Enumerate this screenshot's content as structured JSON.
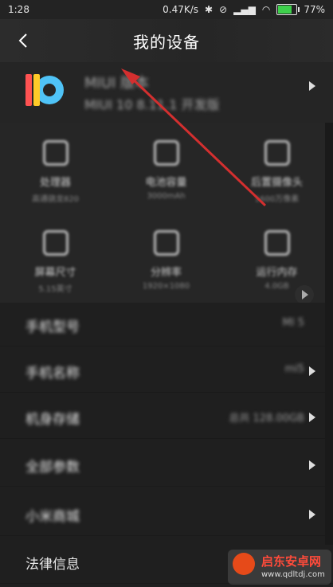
{
  "status": {
    "time": "1:28",
    "net_speed": "0.47K/s",
    "battery": "77%",
    "battery_level": 0.77,
    "battery_color": "#3ed04c"
  },
  "header": {
    "title": "我的设备",
    "back_icon": "chevron-left-icon"
  },
  "miui": {
    "title": "MIUI 版本",
    "version": "MIUI 10 8.11.1 开发版"
  },
  "grid": [
    {
      "label": "处理器",
      "sub": "高通骁龙820"
    },
    {
      "label": "电池容量",
      "sub": "3000mAh"
    },
    {
      "label": "后置摄像头",
      "sub": "1600万像素"
    },
    {
      "label": "屏幕尺寸",
      "sub": "5.15英寸"
    },
    {
      "label": "分辨率",
      "sub": "1920×1080"
    },
    {
      "label": "运行内存",
      "sub": "4.0GB"
    }
  ],
  "list": [
    {
      "label": "手机型号",
      "value": "MI 5"
    },
    {
      "label": "手机名称",
      "value": "mi5"
    },
    {
      "label": "机身存储",
      "value": "总共 128.00GB"
    },
    {
      "label": "全部参数",
      "value": ""
    },
    {
      "label": "小米商城",
      "value": ""
    },
    {
      "label": "法律信息",
      "value": ""
    }
  ],
  "watermark": {
    "name": "启东安卓网",
    "url": "www.qdltdj.com"
  },
  "annotation": {
    "arrow_color": "#d32f2f"
  }
}
